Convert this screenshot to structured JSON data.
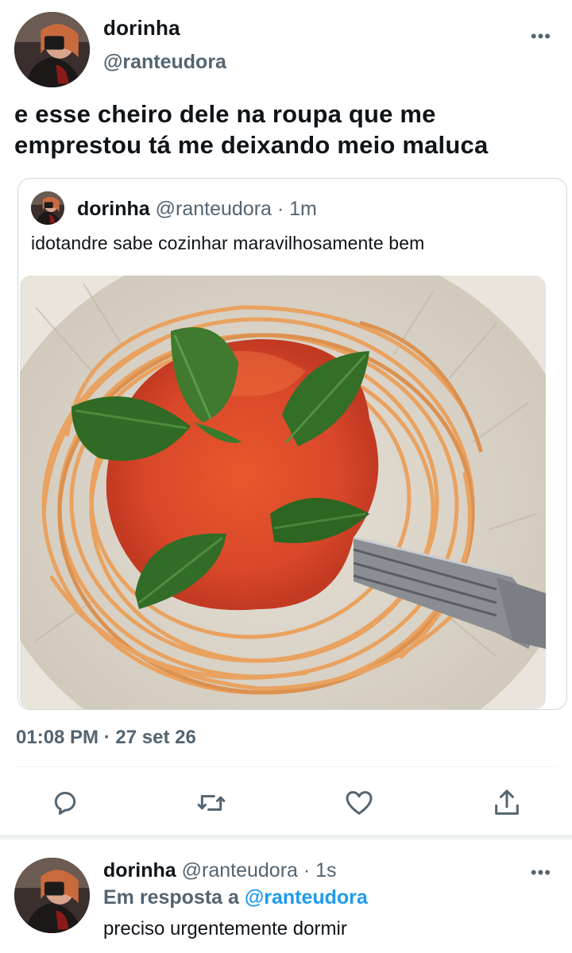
{
  "tweet": {
    "author": {
      "name": "dorinha",
      "handle": "@ranteudora"
    },
    "more_icon": "more-horizontal-icon",
    "text": "e esse cheiro dele na roupa que me emprestou tá me deixando meio maluca",
    "quote": {
      "name": "dorinha",
      "handle": "@ranteudora",
      "separator": " · ",
      "time": "1m",
      "text": "idotandre sabe cozinhar maravilhosamente bem",
      "image_subject": "plate-of-spaghetti-with-tomato-sauce-basil-and-fork"
    },
    "timestamp": "01:08 PM · 27 set 26",
    "actions": [
      "reply-icon",
      "retweet-icon",
      "like-icon",
      "share-icon"
    ]
  },
  "reply": {
    "name": "dorinha",
    "handle": "@ranteudora",
    "separator": " · ",
    "time": "1s",
    "replying_prefix": "Em resposta a ",
    "replying_to": "@ranteudora",
    "text": "preciso urgentemente dormir"
  },
  "colors": {
    "text": "#0f1419",
    "secondary": "#536471",
    "link": "#1d9bf0",
    "border": "#cfd9de"
  }
}
